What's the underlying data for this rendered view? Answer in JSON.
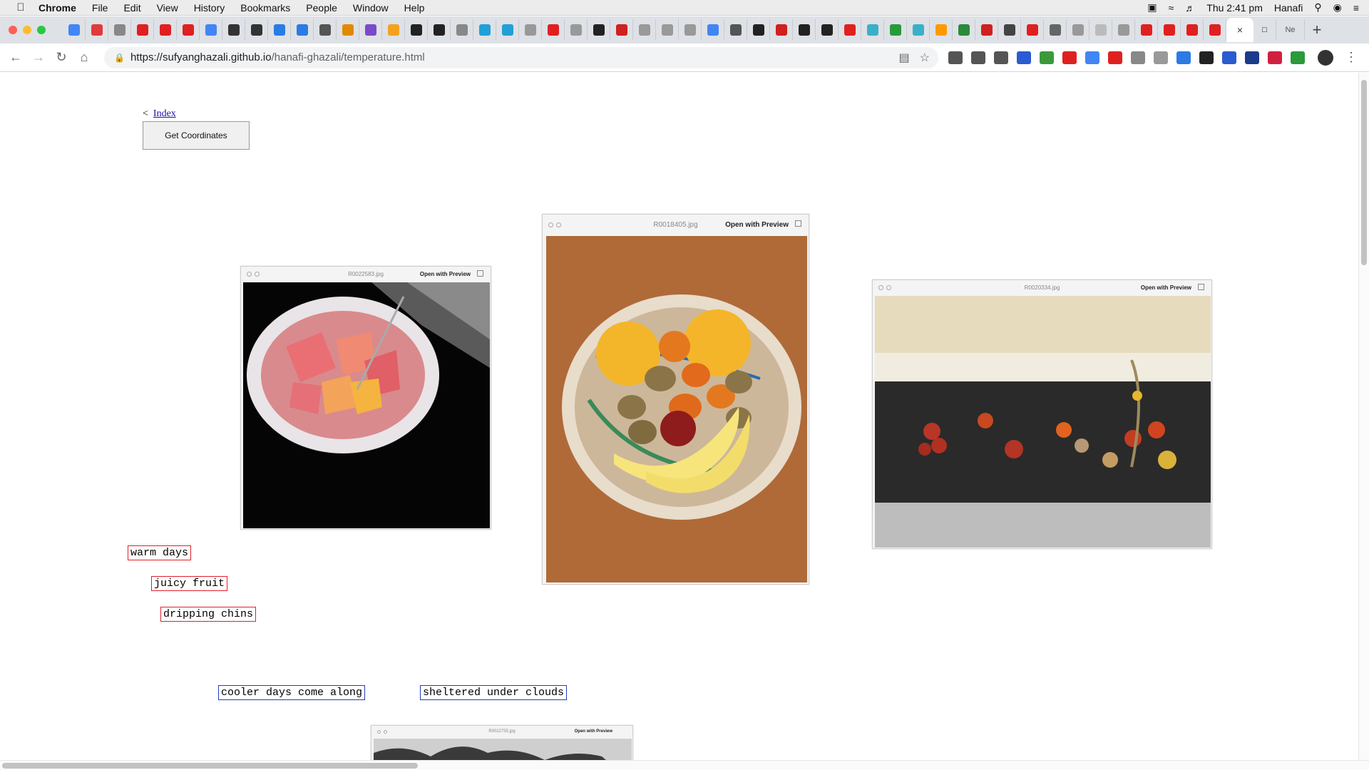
{
  "menubar": {
    "app_name": "Chrome",
    "items": [
      "File",
      "Edit",
      "View",
      "History",
      "Bookmarks",
      "People",
      "Window",
      "Help"
    ],
    "clock": "Thu 2:41 pm",
    "user": "Hanafi"
  },
  "tabs": {
    "active_close": "×",
    "last_tab_label": "Ne",
    "new_tab": "+"
  },
  "toolbar": {
    "url_host": "https://sufyanghazali.github.io",
    "url_path": "/hanafi-ghazali/temperature.html"
  },
  "page": {
    "back_marker": "<",
    "index_link": "Index",
    "coords_button": "Get Coordinates",
    "photos": [
      {
        "file": "R0022583.jpg",
        "open": "Open with Preview"
      },
      {
        "file": "R0018405.jpg",
        "open": "Open with Preview"
      },
      {
        "file": "R0020334.jpg",
        "open": "Open with Preview"
      },
      {
        "file": "R0022755.jpg",
        "open": "Open with Preview"
      }
    ],
    "tags": [
      {
        "text": "warm days",
        "color": "#e0202a"
      },
      {
        "text": "juicy fruit",
        "color": "#e0202a"
      },
      {
        "text": "dripping chins",
        "color": "#e0202a"
      },
      {
        "text": "cooler days come along",
        "color": "#1c3cc8"
      },
      {
        "text": "sheltered under clouds",
        "color": "#1c3cc8"
      }
    ]
  }
}
